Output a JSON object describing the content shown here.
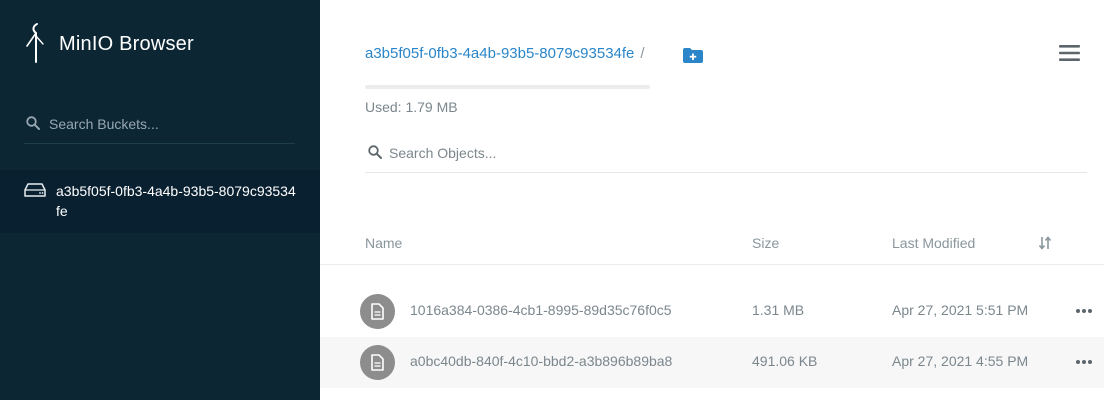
{
  "sidebar": {
    "app_title": "MinIO Browser",
    "search": {
      "placeholder": "Search Buckets..."
    },
    "buckets": [
      {
        "name": "a3b5f05f-0fb3-4a4b-93b5-8079c93534fe",
        "icon": "disk-icon"
      }
    ]
  },
  "main": {
    "breadcrumb": {
      "bucket": "a3b5f05f-0fb3-4a4b-93b5-8079c93534fe",
      "separator": "/"
    },
    "usage": {
      "label": "Used: 1.79 MB",
      "fraction": 0.0
    },
    "search": {
      "placeholder": "Search Objects..."
    },
    "table": {
      "headers": {
        "name": "Name",
        "size": "Size",
        "modified": "Last Modified"
      },
      "rows": [
        {
          "name": "1016a384-0386-4cb1-8995-89d35c76f0c5",
          "size": "1.31 MB",
          "modified": "Apr 27, 2021 5:51 PM"
        },
        {
          "name": "a0bc40db-840f-4c10-bbd2-a3b896b89ba8",
          "size": "491.06 KB",
          "modified": "Apr 27, 2021 4:55 PM"
        }
      ]
    }
  },
  "colors": {
    "sidebar_bg": "#0c2634",
    "accent": "#2a86c9",
    "muted_text": "#7b878d"
  }
}
